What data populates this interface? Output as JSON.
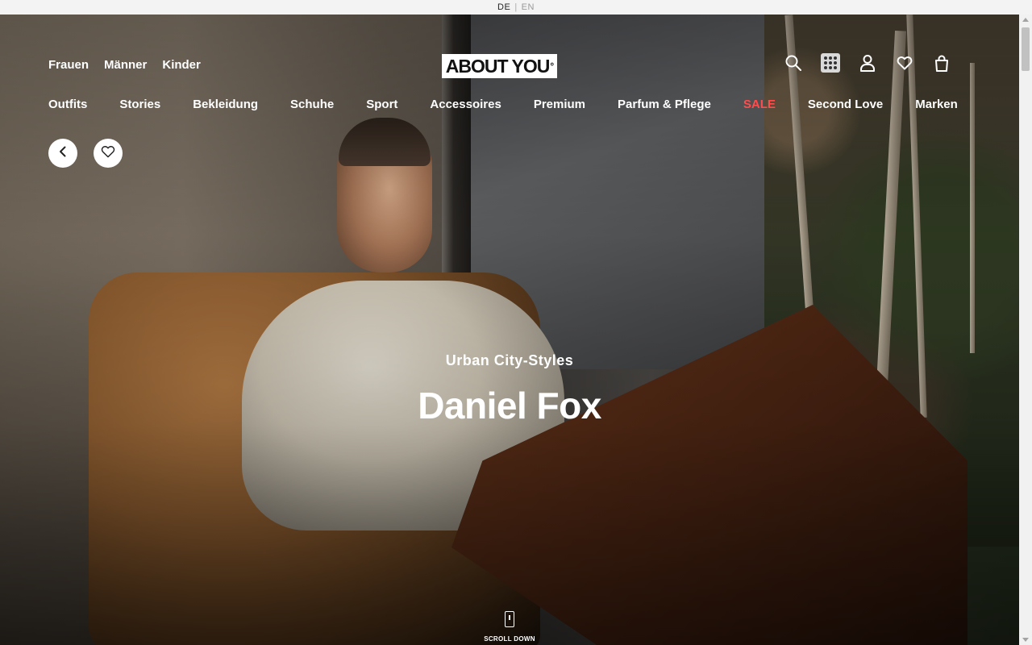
{
  "language_bar": {
    "active": "DE",
    "separator": "|",
    "inactive": "EN"
  },
  "header": {
    "top_nav": [
      "Frauen",
      "Männer",
      "Kinder"
    ],
    "logo_text": "ABOUT YOU",
    "logo_mark": "°",
    "icons": [
      "search-icon",
      "apps-grid-icon",
      "user-icon",
      "heart-icon",
      "shopping-bag-icon"
    ],
    "main_nav": [
      {
        "label": "Outfits",
        "highlight": false
      },
      {
        "label": "Stories",
        "highlight": false
      },
      {
        "label": "Bekleidung",
        "highlight": false
      },
      {
        "label": "Schuhe",
        "highlight": false
      },
      {
        "label": "Sport",
        "highlight": false
      },
      {
        "label": "Accessoires",
        "highlight": false
      },
      {
        "label": "Premium",
        "highlight": false
      },
      {
        "label": "Parfum & Pflege",
        "highlight": false
      },
      {
        "label": "SALE",
        "highlight": true
      },
      {
        "label": "Second Love",
        "highlight": false
      },
      {
        "label": "Marken",
        "highlight": false
      }
    ],
    "sale_color": "#ff4d4d"
  },
  "controls": {
    "back_icon": "chevron-left-icon",
    "favorite_icon": "heart-outline-icon"
  },
  "hero": {
    "subtitle": "Urban City-Styles",
    "title": "Daniel Fox",
    "scroll_label": "SCROLL DOWN"
  }
}
